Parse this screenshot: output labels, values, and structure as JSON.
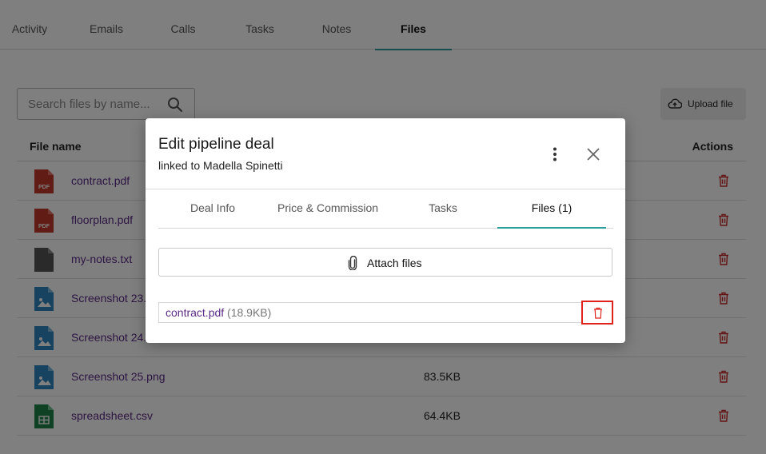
{
  "top_tabs": [
    "Activity",
    "Emails",
    "Calls",
    "Tasks",
    "Notes",
    "Files"
  ],
  "search": {
    "placeholder": "Search files by name..."
  },
  "upload_label": "Upload file",
  "table": {
    "col_name": "File name",
    "col_actions": "Actions",
    "rows": [
      {
        "name": "contract.pdf",
        "size": "",
        "type": "pdf"
      },
      {
        "name": "floorplan.pdf",
        "size": "",
        "type": "pdf"
      },
      {
        "name": "my-notes.txt",
        "size": "",
        "type": "txt"
      },
      {
        "name": "Screenshot 23.",
        "size": "",
        "type": "image"
      },
      {
        "name": "Screenshot 24.",
        "size": "",
        "type": "image"
      },
      {
        "name": "Screenshot 25.png",
        "size": "83.5KB",
        "type": "image"
      },
      {
        "name": "spreadsheet.csv",
        "size": "64.4KB",
        "type": "sheet"
      }
    ]
  },
  "modal": {
    "title": "Edit pipeline deal",
    "subtitle": "linked to Madella Spinetti",
    "tabs": [
      "Deal Info",
      "Price & Commission",
      "Tasks",
      "Files (1)"
    ],
    "attach_label": "Attach files",
    "attached_file": {
      "name": "contract.pdf",
      "size": "(18.9KB)"
    }
  },
  "colors": {
    "accent": "#2a9d9d",
    "link": "#5b2a86",
    "danger": "#c62828",
    "pdf": "#c0392b",
    "image": "#2e86c1",
    "sheet": "#1e8449",
    "txt": "#555555"
  }
}
